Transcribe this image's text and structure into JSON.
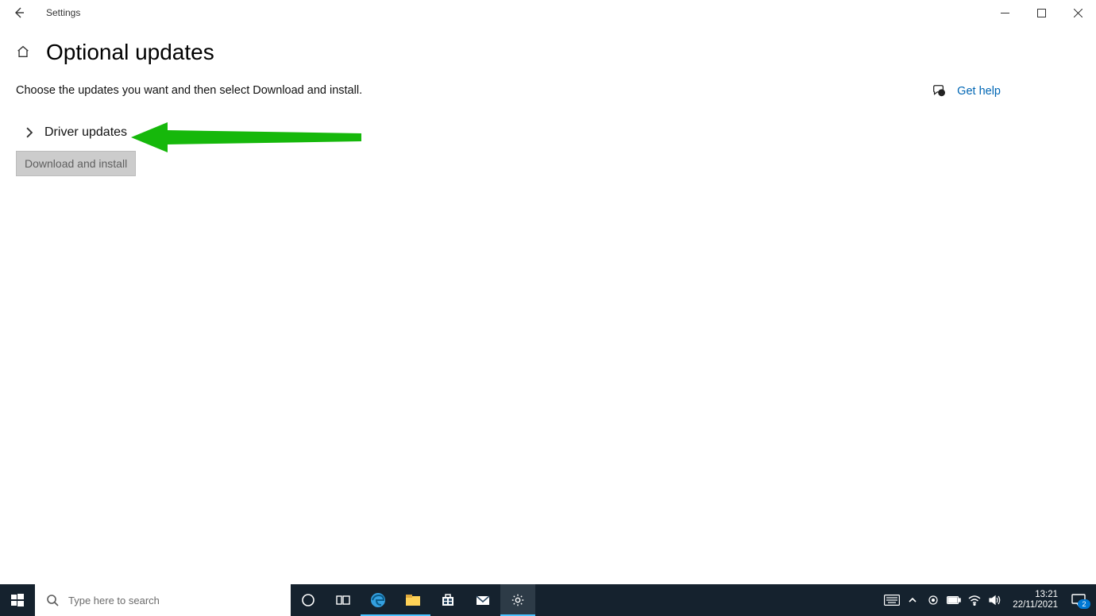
{
  "titlebar": {
    "title": "Settings"
  },
  "page": {
    "title": "Optional updates",
    "description": "Choose the updates you want and then select Download and install."
  },
  "expander": {
    "label": "Driver updates"
  },
  "download_button_label": "Download and install",
  "help": {
    "link_label": "Get help"
  },
  "taskbar": {
    "search_placeholder": "Type here to search",
    "time": "13:21",
    "date": "22/11/2021"
  },
  "tray": {
    "action_center_count": "2"
  }
}
